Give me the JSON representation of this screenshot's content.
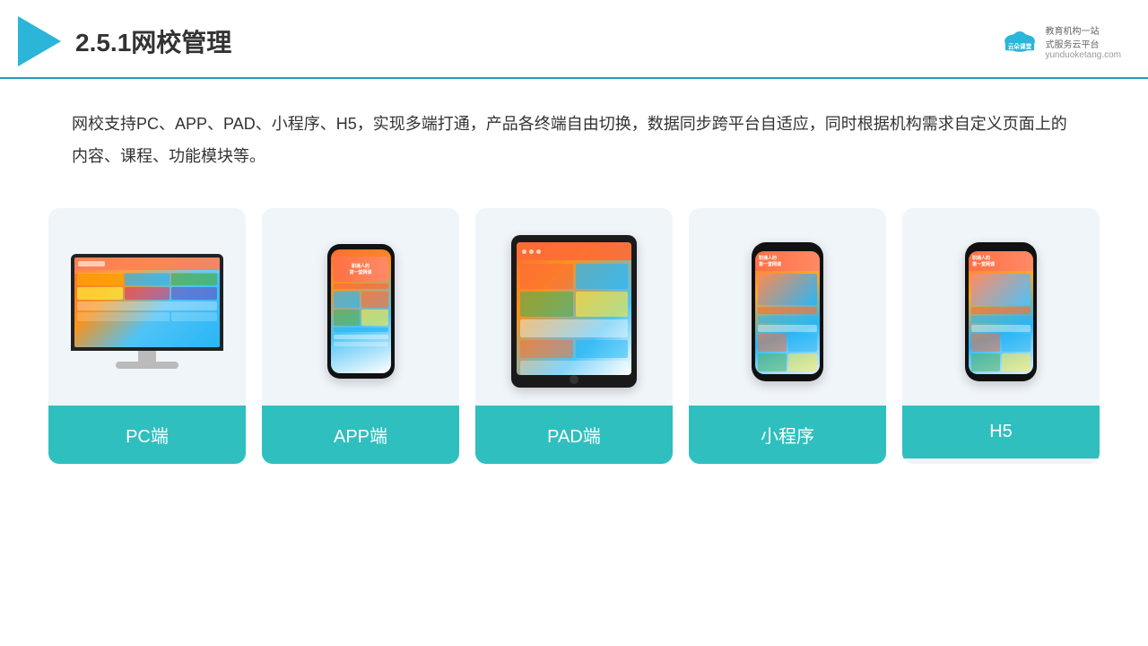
{
  "header": {
    "title": "2.5.1网校管理",
    "brand_name": "云朵课堂",
    "brand_slogan": "教育机构一站\n式服务云平台",
    "brand_url": "yunduoketang.com"
  },
  "description": {
    "text": "网校支持PC、APP、PAD、小程序、H5，实现多端打通，产品各终端自由切换，数据同步跨平台自适应，同时根据机构需求自定义页面上的内容、课程、功能模块等。"
  },
  "cards": [
    {
      "id": "pc",
      "label": "PC端"
    },
    {
      "id": "app",
      "label": "APP端"
    },
    {
      "id": "pad",
      "label": "PAD端"
    },
    {
      "id": "miniapp",
      "label": "小程序"
    },
    {
      "id": "h5",
      "label": "H5"
    }
  ]
}
